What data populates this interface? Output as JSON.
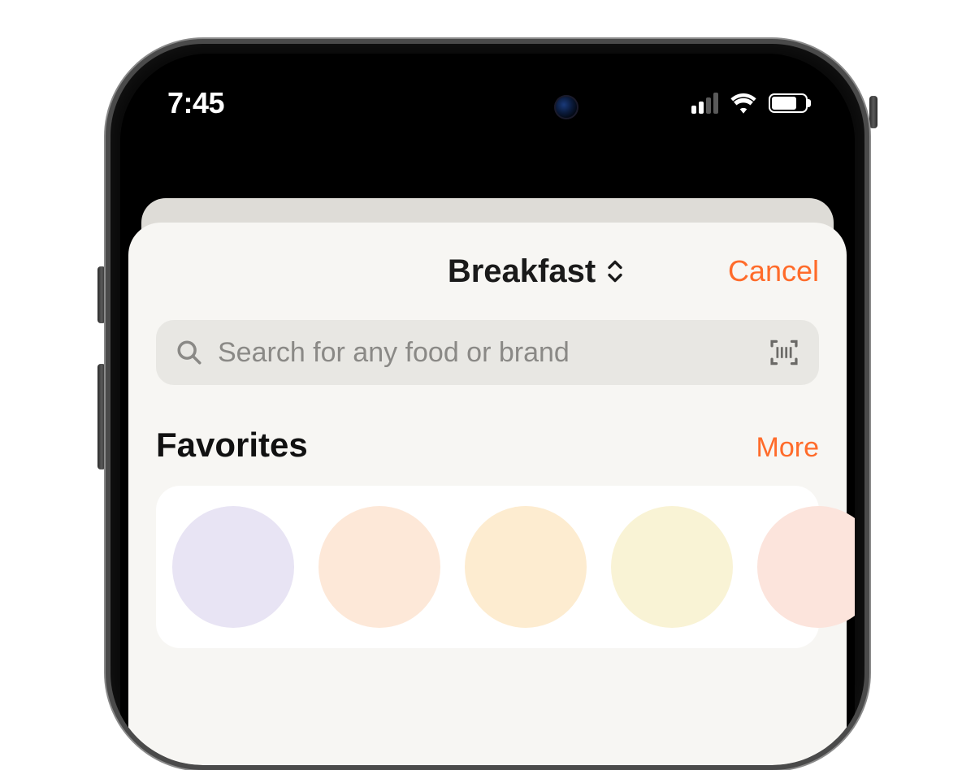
{
  "status": {
    "time": "7:45"
  },
  "sheet": {
    "meal_label": "Breakfast",
    "cancel_label": "Cancel"
  },
  "search": {
    "placeholder": "Search for any food or brand"
  },
  "favorites": {
    "title": "Favorites",
    "more_label": "More"
  },
  "colors": {
    "accent": "#ff6b2a"
  }
}
